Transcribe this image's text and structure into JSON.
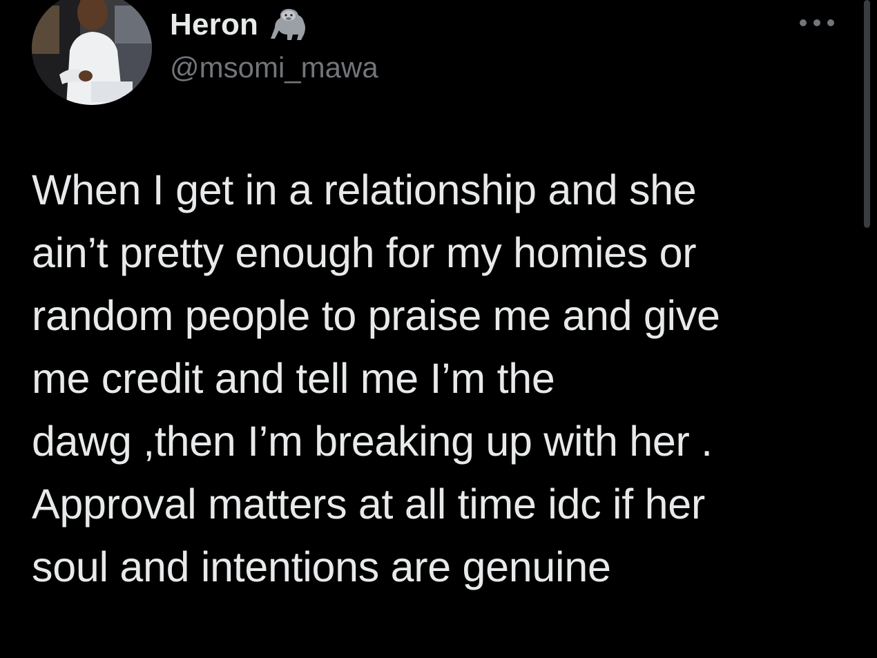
{
  "author": {
    "display_name": "Heron",
    "handle": "@msomi_mawa",
    "name_emoji_icon": "gorilla-icon",
    "avatar": "avatar-photo"
  },
  "more_menu_icon": "more-dots-icon",
  "tweet": {
    "lines": [
      "When I get in a relationship and she",
      "ain’t pretty enough for my homies or",
      "random people to praise me and give",
      "me credit and tell me I’m the",
      "dawg ,then I’m breaking up with her .",
      "Approval matters at all time idc if her",
      "soul and intentions are genuine"
    ]
  },
  "colors": {
    "background": "#000000",
    "text": "#e7e9ea",
    "secondary": "#71767b",
    "accent": "#1d9bf0"
  }
}
